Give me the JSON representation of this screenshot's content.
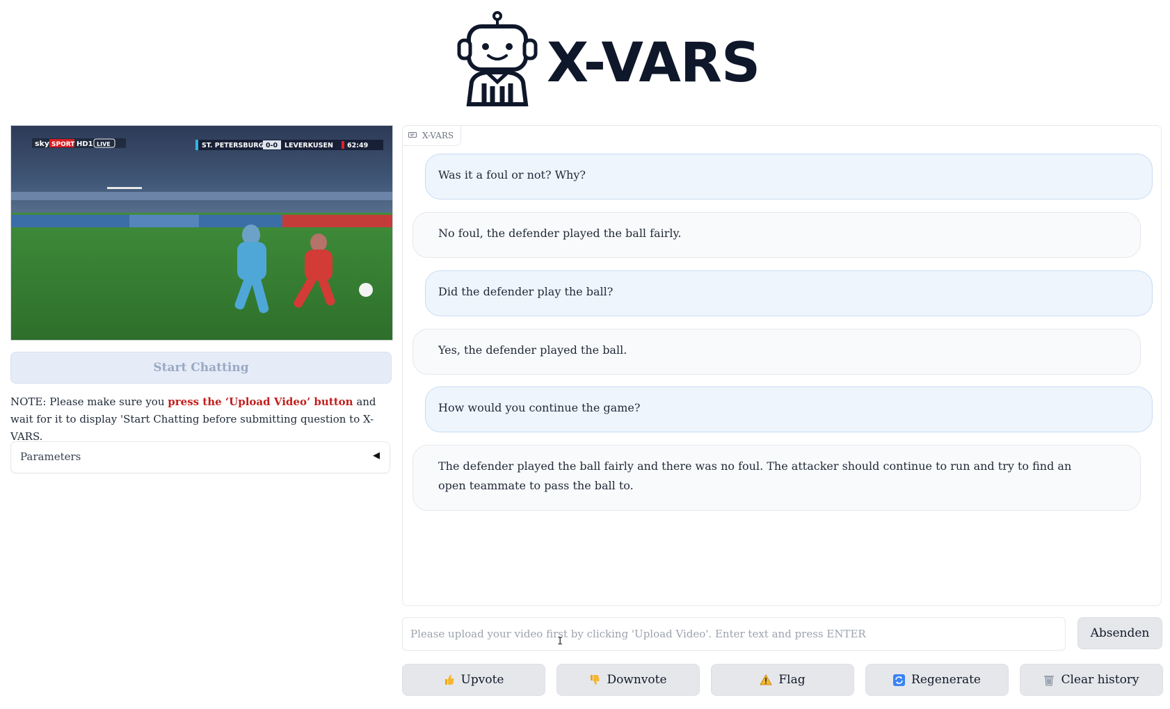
{
  "header": {
    "title": "X-VARS"
  },
  "video": {
    "scoreboard": {
      "broadcaster": "sky",
      "channel": "SPORT",
      "hd_badge": "HD1",
      "live_badge": "LIVE",
      "home_team": "ST. PETERSBURG",
      "score": "0-0",
      "away_team": "LEVERKUSEN",
      "clock": "62:49"
    }
  },
  "left": {
    "start_button": "Start Chatting",
    "note_prefix": "NOTE: Please make sure you ",
    "note_highlight": "press the ‘Upload Video’ button",
    "note_suffix": " and wait for it to display 'Start Chatting before submitting question to X-VARS.",
    "params_label": "Parameters"
  },
  "chat": {
    "label": "X-VARS",
    "messages": [
      {
        "role": "user",
        "text": "Was it a foul or not? Why?"
      },
      {
        "role": "bot",
        "text": "No foul, the defender played the ball fairly."
      },
      {
        "role": "user",
        "text": "Did the defender play the ball?"
      },
      {
        "role": "bot",
        "text": "Yes, the defender played the ball."
      },
      {
        "role": "user",
        "text": "How would you continue the game?"
      },
      {
        "role": "bot",
        "text": "The defender played the ball fairly and there was no foul. The attacker should continue to run and try to find an open teammate to pass the ball to."
      }
    ]
  },
  "input": {
    "placeholder": "Please upload your video first by clicking 'Upload Video'. Enter text and press ENTER",
    "value": "",
    "send_label": "Absenden"
  },
  "actions": {
    "upvote": "Upvote",
    "downvote": "Downvote",
    "flag": "Flag",
    "regenerate": "Regenerate",
    "clear": "Clear history"
  },
  "colors": {
    "note_highlight": "#c0201f",
    "user_bubble": "#eef5fd",
    "bot_bubble": "#f9fafb",
    "button_bg": "#e5e7eb"
  }
}
